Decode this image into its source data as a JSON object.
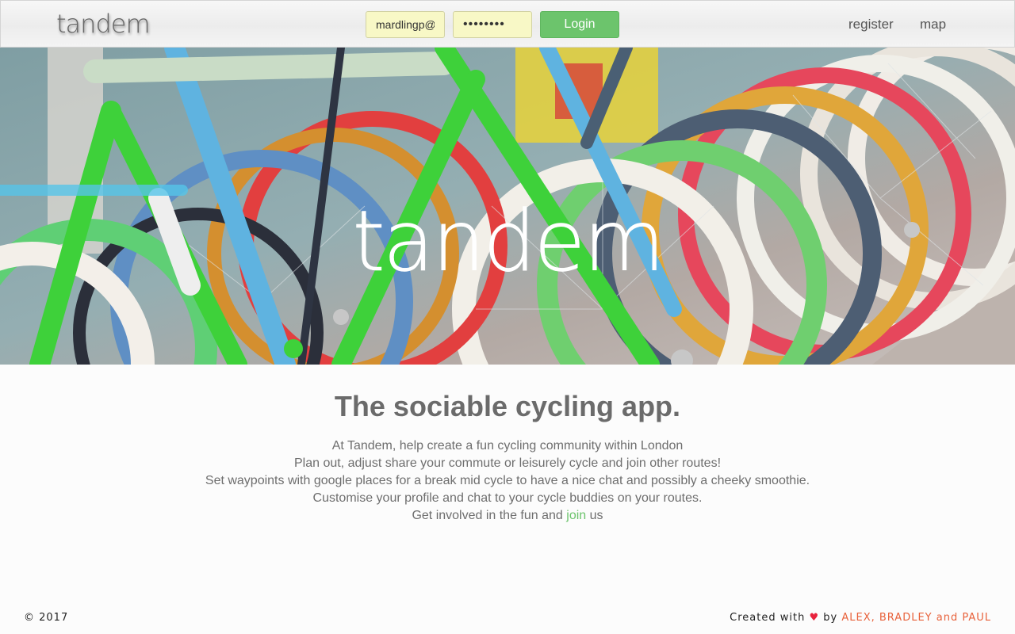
{
  "navbar": {
    "brand": "tandem",
    "email_value": "mardlingp@",
    "password_value": "••••••••",
    "login_label": "Login",
    "links": [
      {
        "label": "register"
      },
      {
        "label": "map"
      }
    ]
  },
  "hero": {
    "title": "tandem"
  },
  "main": {
    "tagline": "The sociable cycling app.",
    "lines": [
      "At Tandem, help create a fun cycling community within London",
      "Plan out, adjust share your commute or leisurely cycle and join other routes!",
      "Set waypoints with google places for a break mid cycle to have a nice chat and possibly a cheeky smoothie.",
      "Customise your profile and chat to your cycle buddies on your routes."
    ],
    "cta_prefix": "Get involved in the fun and",
    "cta_link": "join",
    "cta_suffix": "us"
  },
  "footer": {
    "copyright": "© 2017",
    "created_with": "Created with",
    "heart": "♥",
    "by": "by",
    "authors": "ALEX, BRADLEY and PAUL"
  },
  "colors": {
    "accent_green": "#6cc46c",
    "input_bg": "#f8f8c6",
    "author_orange": "#e8613a",
    "heart_red": "#e8233d"
  }
}
